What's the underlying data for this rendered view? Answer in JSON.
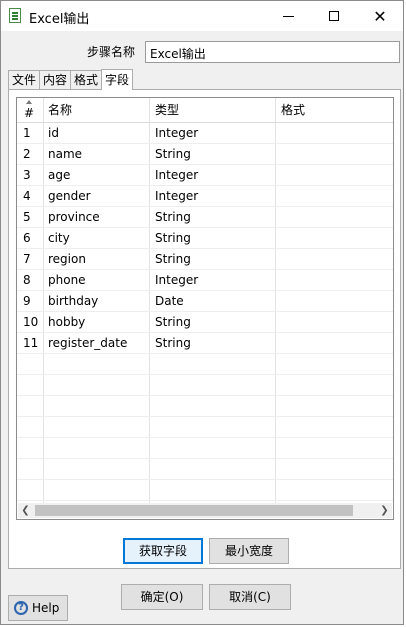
{
  "window": {
    "title": "Excel输出",
    "icon": "excel-output-icon",
    "controls": {
      "minimize": "minimize-icon",
      "maximize": "maximize-icon",
      "close": "✕"
    }
  },
  "step": {
    "label": "步骤名称",
    "value": "Excel输出"
  },
  "tabs": [
    {
      "label": "文件",
      "active": false
    },
    {
      "label": "内容",
      "active": false
    },
    {
      "label": "格式",
      "active": false
    },
    {
      "label": "字段",
      "active": true
    }
  ],
  "table": {
    "columns": [
      "#",
      "名称",
      "类型",
      "格式"
    ],
    "rows": [
      {
        "num": "1",
        "name": "id",
        "type": "Integer",
        "format": ""
      },
      {
        "num": "2",
        "name": "name",
        "type": "String",
        "format": ""
      },
      {
        "num": "3",
        "name": "age",
        "type": "Integer",
        "format": ""
      },
      {
        "num": "4",
        "name": "gender",
        "type": "Integer",
        "format": ""
      },
      {
        "num": "5",
        "name": "province",
        "type": "String",
        "format": ""
      },
      {
        "num": "6",
        "name": "city",
        "type": "String",
        "format": ""
      },
      {
        "num": "7",
        "name": "region",
        "type": "String",
        "format": ""
      },
      {
        "num": "8",
        "name": "phone",
        "type": "Integer",
        "format": ""
      },
      {
        "num": "9",
        "name": "birthday",
        "type": "Date",
        "format": ""
      },
      {
        "num": "10",
        "name": "hobby",
        "type": "String",
        "format": ""
      },
      {
        "num": "11",
        "name": "register_date",
        "type": "String",
        "format": ""
      }
    ]
  },
  "buttons": {
    "get_fields": "获取字段",
    "min_width": "最小宽度",
    "ok": "确定(O)",
    "cancel": "取消(C)",
    "help": "Help"
  },
  "colors": {
    "focus_border": "#0078d7",
    "button_bg": "#e1e1e1",
    "window_bg": "#f0f0f0"
  }
}
